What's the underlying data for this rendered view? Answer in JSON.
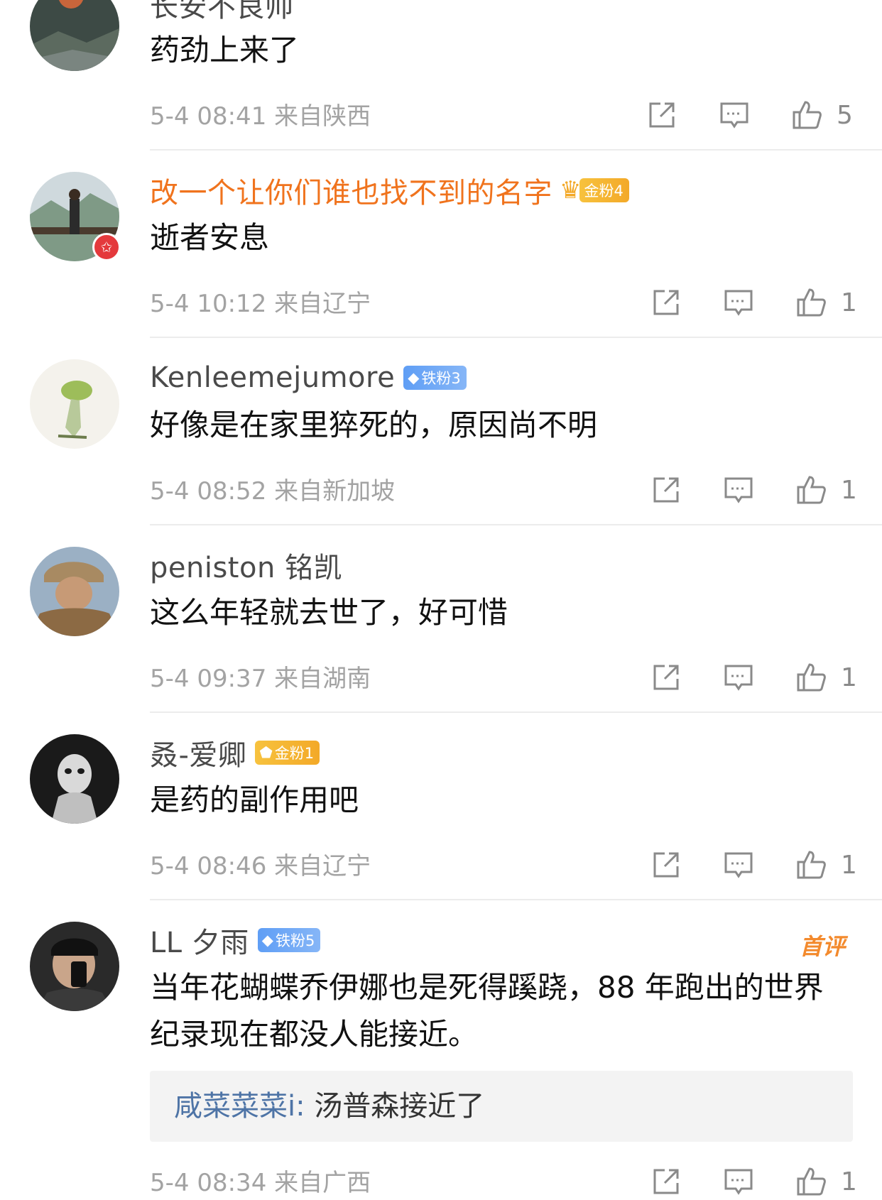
{
  "comments": [
    {
      "username": "长安不良帅",
      "text": "药劲上来了",
      "date": "5-4 08:41",
      "location": "来自陕西",
      "likes": "5"
    },
    {
      "username": "改一个让你们谁也找不到的名字",
      "badge": "金粉4",
      "text": "逝者安息",
      "date": "5-4 10:12",
      "location": "来自辽宁",
      "likes": "1"
    },
    {
      "username": "Kenleemejumore",
      "badge": "铁粉3",
      "text": "好像是在家里猝死的，原因尚不明",
      "date": "5-4 08:52",
      "location": "来自新加坡",
      "likes": "1"
    },
    {
      "username": "peniston 铭凯",
      "text": "这么年轻就去世了，好可惜",
      "date": "5-4 09:37",
      "location": "来自湖南",
      "likes": "1"
    },
    {
      "username": "叒-爱卿",
      "badge": "金粉1",
      "text": "是药的副作用吧",
      "date": "5-4 08:46",
      "location": "来自辽宁",
      "likes": "1"
    },
    {
      "username": "LL 夕雨",
      "badge": "铁粉5",
      "tag": "首评",
      "text": "当年花蝴蝶乔伊娜也是死得蹊跷，88 年跑出的世界纪录现在都没人能接近。",
      "reply_user": "咸菜菜菜i:",
      "reply_text": " 汤普森接近了",
      "date": "5-4 08:34",
      "location": "来自广西",
      "likes": "1"
    }
  ],
  "colors": {
    "orange_name": "#f0731d",
    "meta_gray": "#a3a3a3",
    "reply_link": "#4e74a6",
    "gold_badge": "#f3a928",
    "iron_badge": "#5f9ef5"
  },
  "icons": [
    "share-icon",
    "comment-icon",
    "like-icon"
  ]
}
